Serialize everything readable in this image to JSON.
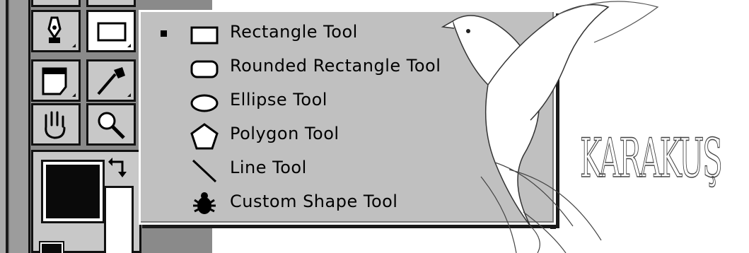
{
  "flyout": {
    "items": [
      {
        "label": "Rectangle Tool",
        "icon": "rectangle-icon",
        "selected": true
      },
      {
        "label": "Rounded Rectangle Tool",
        "icon": "rounded-rectangle-icon",
        "selected": false
      },
      {
        "label": "Ellipse Tool",
        "icon": "ellipse-icon",
        "selected": false
      },
      {
        "label": "Polygon Tool",
        "icon": "polygon-icon",
        "selected": false
      },
      {
        "label": "Line Tool",
        "icon": "line-icon",
        "selected": false
      },
      {
        "label": "Custom Shape Tool",
        "icon": "custom-shape-icon",
        "selected": false
      }
    ]
  },
  "toolbox": {
    "tools": [
      "pen-tool-icon",
      "rectangle-tool-icon",
      "notes-tool-icon",
      "eyedropper-tool-icon",
      "hand-tool-icon",
      "zoom-tool-icon"
    ]
  },
  "watermark": {
    "text": "KARAKUŞ"
  },
  "colors": {
    "menu_bg": "#c0c0c0",
    "toolbox_bg": "#8a8a8a",
    "foreground": "#0a0a0a",
    "background": "#ffffff"
  }
}
